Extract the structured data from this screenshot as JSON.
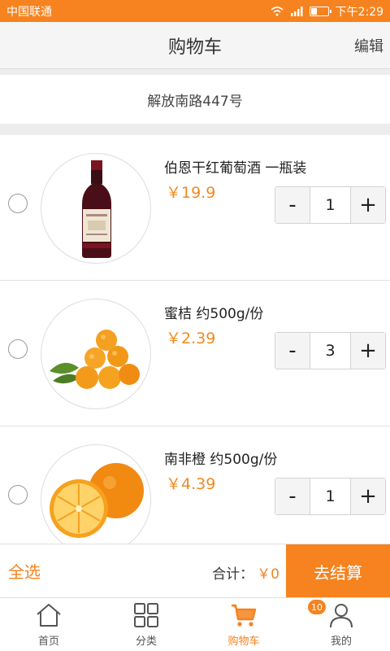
{
  "status_bar": {
    "carrier": "中国联通",
    "time": "下午2:29",
    "battery_level": 0.35
  },
  "header": {
    "title": "购物车",
    "edit_label": "编辑"
  },
  "address": "解放南路447号",
  "cart_items": [
    {
      "name": "伯恩干红葡萄酒 一瓶装",
      "price": "￥19.9",
      "quantity": "1",
      "minus_label": "-",
      "plus_label": "+",
      "image_icon": "wine-bottle-icon"
    },
    {
      "name": "蜜桔 约500g/份",
      "price": "￥2.39",
      "quantity": "3",
      "minus_label": "-",
      "plus_label": "+",
      "image_icon": "tangerine-icon"
    },
    {
      "name": "南非橙 约500g/份",
      "price": "￥4.39",
      "quantity": "1",
      "minus_label": "-",
      "plus_label": "+",
      "image_icon": "orange-icon"
    }
  ],
  "checkout": {
    "select_all_label": "全选",
    "total_label": "合计：",
    "total_amount": "￥0",
    "checkout_label": "去结算"
  },
  "tabbar": {
    "items": [
      {
        "label": "首页",
        "icon": "home-icon"
      },
      {
        "label": "分类",
        "icon": "category-grid-icon"
      },
      {
        "label": "购物车",
        "icon": "cart-icon",
        "badge": "10",
        "active": true
      },
      {
        "label": "我的",
        "icon": "user-icon"
      }
    ]
  },
  "colors": {
    "accent": "#f6831f",
    "price": "#f08a1e"
  }
}
